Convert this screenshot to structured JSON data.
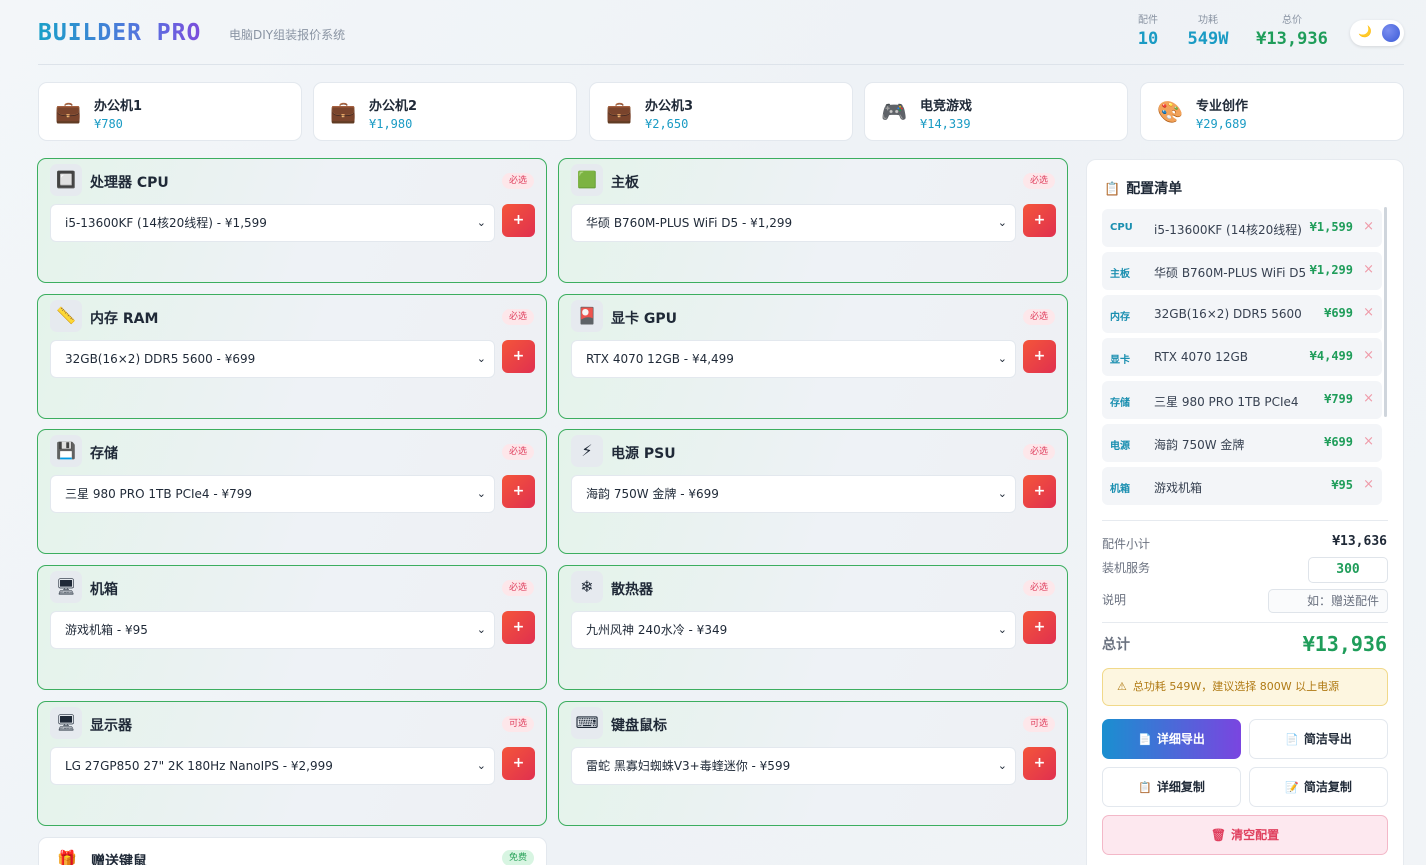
{
  "header": {
    "brand": "BUILDER PRO",
    "subtitle": "电脑DIY组装报价系统",
    "stats": [
      {
        "label": "配件",
        "value": "10",
        "color": "#1a9bc4"
      },
      {
        "label": "功耗",
        "value": "549W",
        "color": "#1a9bc4"
      },
      {
        "label": "总价",
        "value": "¥13,936",
        "color": "#1f9d5a"
      }
    ],
    "theme_toggle_icon": "moon-icon"
  },
  "presets": [
    {
      "name": "办公机1",
      "price": "¥780",
      "icon": "💼"
    },
    {
      "name": "办公机2",
      "price": "¥1,980",
      "icon": "💼"
    },
    {
      "name": "办公机3",
      "price": "¥2,650",
      "icon": "💼"
    },
    {
      "name": "电竞游戏",
      "price": "¥14,339",
      "icon": "🎮"
    },
    {
      "name": "专业创作",
      "price": "¥29,689",
      "icon": "🎨"
    }
  ],
  "parts": [
    {
      "title": "处理器 CPU",
      "tag": "必选",
      "icon": "🔲",
      "selected": "i5-13600KF (14核20线程) - ¥1,599"
    },
    {
      "title": "主板",
      "tag": "必选",
      "icon": "🟩",
      "selected": "华硕 B760M-PLUS WiFi D5 - ¥1,299"
    },
    {
      "title": "内存 RAM",
      "tag": "必选",
      "icon": "📏",
      "selected": "32GB(16×2) DDR5 5600 - ¥699"
    },
    {
      "title": "显卡 GPU",
      "tag": "必选",
      "icon": "🎴",
      "selected": "RTX 4070 12GB - ¥4,499"
    },
    {
      "title": "存储",
      "tag": "必选",
      "icon": "💾",
      "selected": "三星 980 PRO 1TB PCIe4 - ¥799"
    },
    {
      "title": "电源 PSU",
      "tag": "必选",
      "icon": "⚡",
      "selected": "海韵 750W 金牌 - ¥699"
    },
    {
      "title": "机箱",
      "tag": "必选",
      "icon": "🖥",
      "selected": "游戏机箱 - ¥95"
    },
    {
      "title": "散热器",
      "tag": "必选",
      "icon": "❄",
      "selected": "九州风神 240水冷 - ¥349"
    },
    {
      "title": "显示器",
      "tag": "可选",
      "icon": "🖥",
      "selected": "LG 27GP850 27\" 2K 180Hz NanoIPS - ¥2,999"
    },
    {
      "title": "键盘鼠标",
      "tag": "可选",
      "icon": "⌨",
      "selected": "雷蛇 黑寡妇蜘蛛V3+毒蝰迷你 - ¥599"
    }
  ],
  "gift": {
    "title": "赠送键鼠",
    "tag": "免费",
    "icon": "🎁"
  },
  "add_label": "+",
  "summary": {
    "title": "配置清单",
    "items": [
      {
        "cat": "CPU",
        "name": "i5-13600KF (14核20线程)",
        "price": "¥1,599"
      },
      {
        "cat": "主板",
        "name": "华硕 B760M-PLUS WiFi D5",
        "price": "¥1,299"
      },
      {
        "cat": "内存",
        "name": "32GB(16×2) DDR5 5600",
        "price": "¥699"
      },
      {
        "cat": "显卡",
        "name": "RTX 4070 12GB",
        "price": "¥4,499"
      },
      {
        "cat": "存储",
        "name": "三星 980 PRO 1TB PCIe4",
        "price": "¥799"
      },
      {
        "cat": "电源",
        "name": "海韵 750W 金牌",
        "price": "¥699"
      },
      {
        "cat": "机箱",
        "name": "游戏机箱",
        "price": "¥95"
      }
    ],
    "remove_label": "×",
    "subtotal_label": "配件小计",
    "subtotal_value": "¥13,636",
    "service_label": "装机服务",
    "service_value": "300",
    "note_label": "说明",
    "note_placeholder": "如：赠送配件",
    "total_label": "总计",
    "total_value": "¥13,936",
    "warning": "总功耗 549W，建议选择 800W 以上电源",
    "buttons": {
      "detail_export": "详细导出",
      "simple_export": "简洁导出",
      "detail_copy": "详细复制",
      "simple_copy": "简洁复制",
      "clear": "清空配置"
    }
  }
}
